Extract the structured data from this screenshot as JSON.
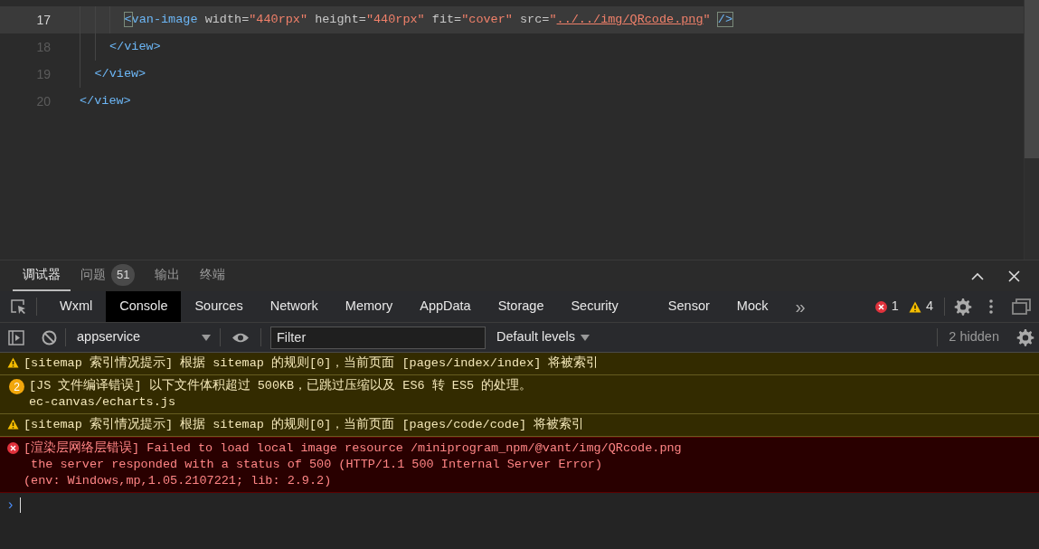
{
  "editor": {
    "lines": [
      {
        "children": [
          {
            "children": [
              {
                "children": [
                  {
                    "number": "17",
                    "selected": true,
                    "tokens": [
                      {
                        "kind": "bracket",
                        "text": "<"
                      },
                      {
                        "kind": "tag",
                        "text": "van-image"
                      },
                      {
                        "kind": "attr",
                        "text": " width="
                      },
                      {
                        "kind": "string",
                        "text": "\"440rpx\""
                      },
                      {
                        "kind": "attr",
                        "text": " height="
                      },
                      {
                        "kind": "string",
                        "text": "\"440rpx\""
                      },
                      {
                        "kind": "attr",
                        "text": " fit="
                      },
                      {
                        "kind": "string",
                        "text": "\"cover\""
                      },
                      {
                        "kind": "attr",
                        "text": " src="
                      },
                      {
                        "kind": "string",
                        "text": "\""
                      },
                      {
                        "kind": "link",
                        "text": "../../img/QRcode.png"
                      },
                      {
                        "kind": "string",
                        "text": "\" "
                      },
                      {
                        "kind": "bracket",
                        "text": "/>"
                      }
                    ]
                  }
                ]
              },
              {
                "number": "18",
                "selected": false,
                "tokens": [
                  {
                    "kind": "tag",
                    "text": "</view>"
                  }
                ]
              }
            ]
          },
          {
            "number": "19",
            "selected": false,
            "tokens": [
              {
                "kind": "tag",
                "text": "</view>"
              }
            ]
          }
        ]
      },
      {
        "number": "20",
        "selected": false,
        "tokens": [
          {
            "kind": "tag",
            "text": "</view>"
          }
        ]
      }
    ]
  },
  "panel_tabs": [
    {
      "label": "调试器",
      "selected": true
    },
    {
      "label": "问题",
      "selected": false,
      "count": "51"
    },
    {
      "label": "输出",
      "selected": false
    },
    {
      "label": "终端",
      "selected": false
    }
  ],
  "devtools_tabs": [
    {
      "label": "Wxml",
      "selected": false
    },
    {
      "label": "Console",
      "selected": true
    },
    {
      "label": "Sources",
      "selected": false
    },
    {
      "label": "Network",
      "selected": false
    },
    {
      "label": "Memory",
      "selected": false
    },
    {
      "label": "AppData",
      "selected": false
    },
    {
      "label": "Storage",
      "selected": false
    },
    {
      "label": "Security",
      "selected": false
    },
    {
      "label": "Sensor",
      "selected": false
    },
    {
      "label": "Mock",
      "selected": false
    }
  ],
  "more_tabs": "»",
  "error_count": "1",
  "warning_count": "4",
  "toolbar": {
    "context": "appservice",
    "filter_placeholder": "Filter",
    "levels": "Default levels",
    "hidden": "2 hidden"
  },
  "messages": [
    {
      "kind": "warning",
      "lines": [
        "[sitemap 索引情况提示] 根据 sitemap 的规则[0]，当前页面 [pages/index/index] 将被索引"
      ]
    },
    {
      "kind": "notice",
      "repeat": "2",
      "lines": [
        "[JS 文件编译错误] 以下文件体积超过 500KB，已跳过压缩以及 ES6 转 ES5 的处理。",
        "ec-canvas/echarts.js"
      ]
    },
    {
      "kind": "warning",
      "lines": [
        "[sitemap 索引情况提示] 根据 sitemap 的规则[0]，当前页面 [pages/code/code] 将被索引"
      ]
    },
    {
      "kind": "error",
      "lines": [
        "[渲染层网络层错误] Failed to load local image resource /miniprogram_npm/@vant/img/QRcode.png",
        " the server responded with a status of 500 (HTTP/1.1 500 Internal Server Error)",
        "(env: Windows,mp,1.05.2107221; lib: 2.9.2)"
      ]
    }
  ],
  "prompt": "›"
}
